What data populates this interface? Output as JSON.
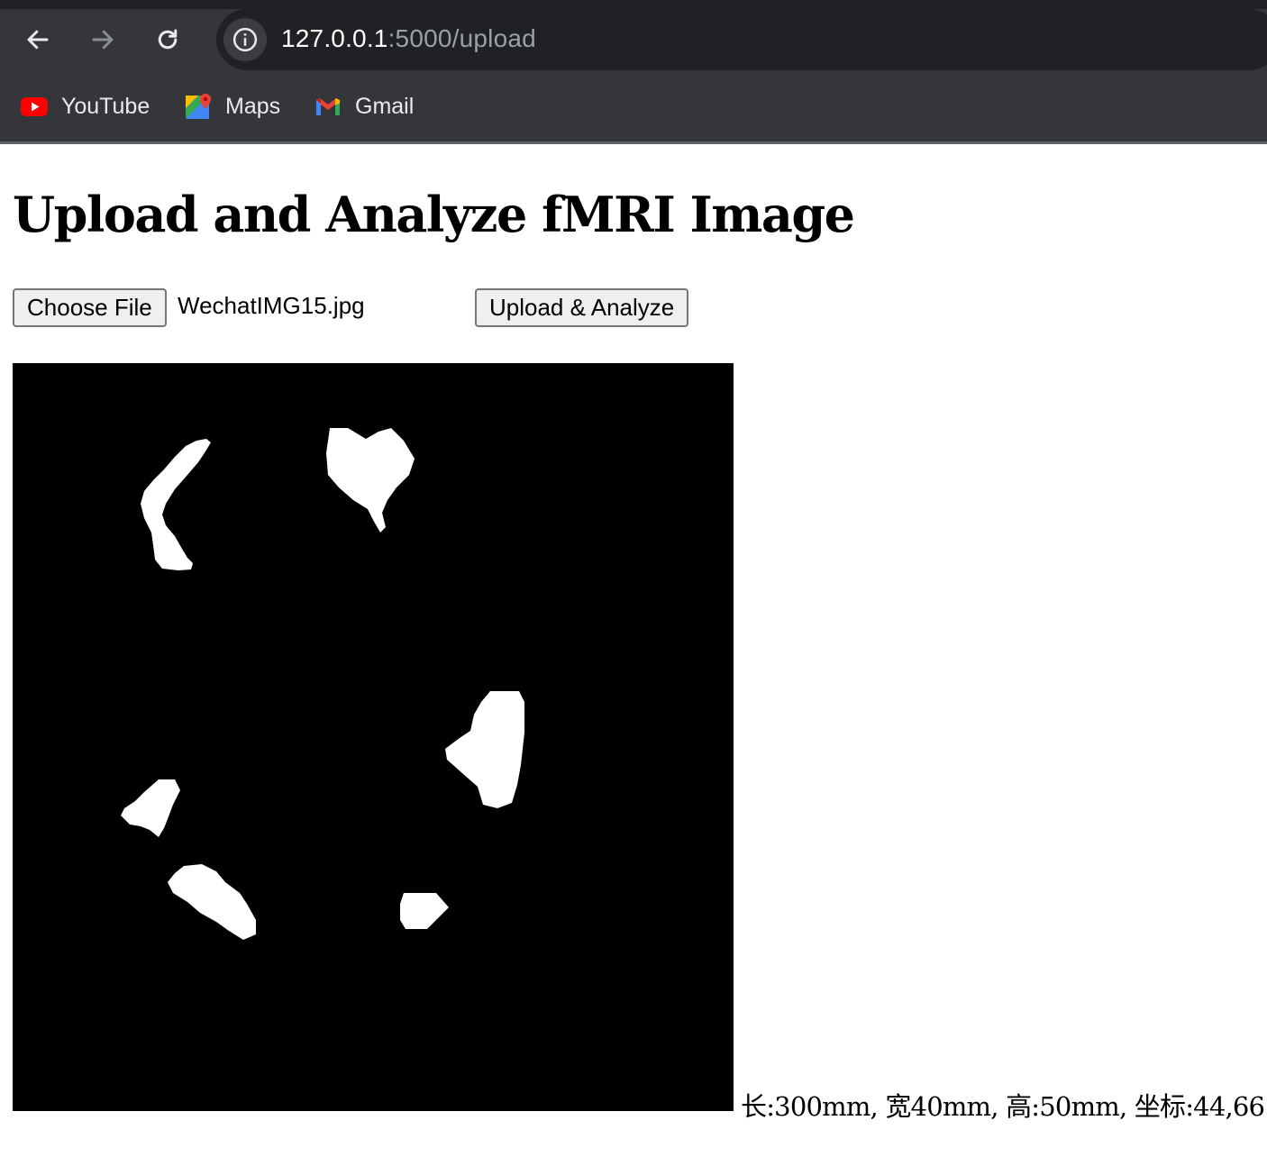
{
  "browser": {
    "url_host": "127.0.0.1",
    "url_path": ":5000/upload",
    "nav": {
      "back_icon": "arrow-left-icon",
      "forward_icon": "arrow-right-icon",
      "reload_icon": "reload-icon",
      "site_info_icon": "info-icon"
    },
    "bookmarks": [
      {
        "label": "YouTube",
        "icon": "youtube-icon"
      },
      {
        "label": "Maps",
        "icon": "maps-icon"
      },
      {
        "label": "Gmail",
        "icon": "gmail-icon"
      }
    ],
    "colors": {
      "toolbar": "#35363a",
      "omnibox": "#202124",
      "text": "#e8eaed"
    }
  },
  "page": {
    "title": "Upload and Analyze fMRI Image",
    "choose_file_label": "Choose File",
    "selected_file": "WechatIMG15.jpg",
    "submit_label": "Upload & Analyze",
    "result_text": "长:300mm, 宽40mm, 高:50mm, 坐标:44,66",
    "image": {
      "description_icon": "fmri-result-image",
      "background": "#000000",
      "blob_color": "#ffffff"
    }
  }
}
